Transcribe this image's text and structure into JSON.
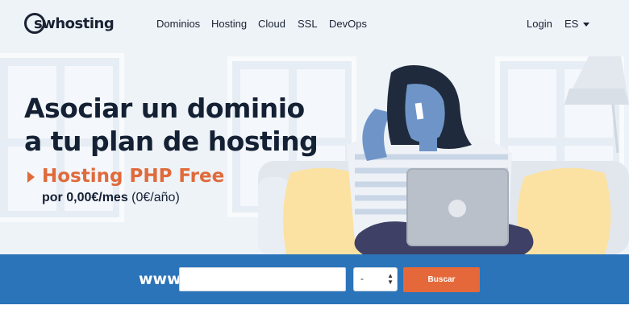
{
  "brand": {
    "logo_text": "swhosting"
  },
  "nav": {
    "items": [
      {
        "label": "Dominios"
      },
      {
        "label": "Hosting"
      },
      {
        "label": "Cloud"
      },
      {
        "label": "SSL"
      },
      {
        "label": "DevOps"
      }
    ],
    "login": "Login",
    "language": "ES"
  },
  "hero": {
    "headline": "Asociar un dominio a tu plan de hosting",
    "promo_title": "Hosting PHP Free",
    "promo_price_bold": "por 0,00€/mes",
    "promo_price_rest": " (0€/año)"
  },
  "search": {
    "prefix": "www.",
    "input_value": "",
    "tld_selected": "-",
    "button_label": "Buscar"
  },
  "colors": {
    "accent_orange": "#e06a3b",
    "search_band_blue": "#2b74b9",
    "text_dark": "#142033"
  }
}
